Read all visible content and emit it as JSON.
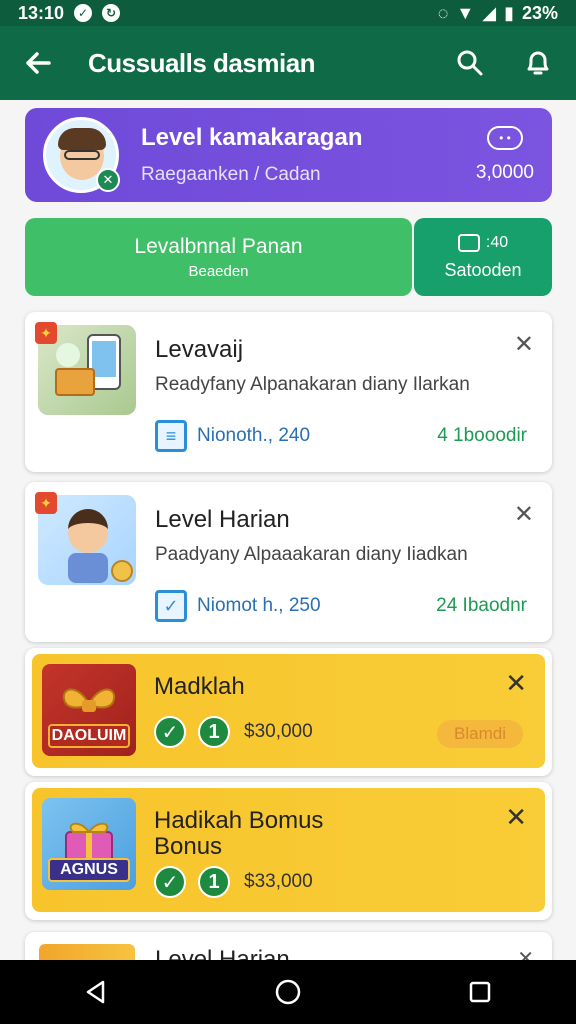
{
  "status_bar": {
    "time": "13:10",
    "battery": "23%"
  },
  "app_bar": {
    "title": "Cussualls dasmian"
  },
  "profile": {
    "title": "Level kamakaragan",
    "subtitle": "Raegaanken / Cadan",
    "value": "3,0000"
  },
  "actions": {
    "main_label": "Levalbnnal Panan",
    "main_sub": "Beaeden",
    "side_count": ":40",
    "side_label": "Satooden"
  },
  "tasks": [
    {
      "title": "Levavaij",
      "desc": "Readyfany Alpanakaran diany Ilarkan",
      "footer_value": "Nionoth., 240",
      "footer_right": "4 1booodir"
    },
    {
      "title": "Level Harian",
      "desc": "Paadyany Alpaaakaran diany Iiadkan",
      "footer_value": "Niomot h., 250",
      "footer_right": "24 Ibaodnr"
    }
  ],
  "rewards": [
    {
      "title": "Madklah",
      "badge": "DAOLUIM",
      "amount": "$30,000",
      "pill": "Blamdi",
      "step": "1"
    },
    {
      "title": "Hadikah Bomus Bonus",
      "badge": "AGNUS",
      "amount": "$33,000",
      "step": "1"
    }
  ],
  "partial": {
    "title": "Level Harian"
  },
  "icons": [
    "back-arrow-icon",
    "search-icon",
    "notification-icon",
    "close-icon",
    "check-icon",
    "home-icon"
  ],
  "colors": {
    "primary": "#0f6b47",
    "purple": "#7350dc",
    "green": "#3fbf68",
    "gold": "#f7c42c"
  }
}
